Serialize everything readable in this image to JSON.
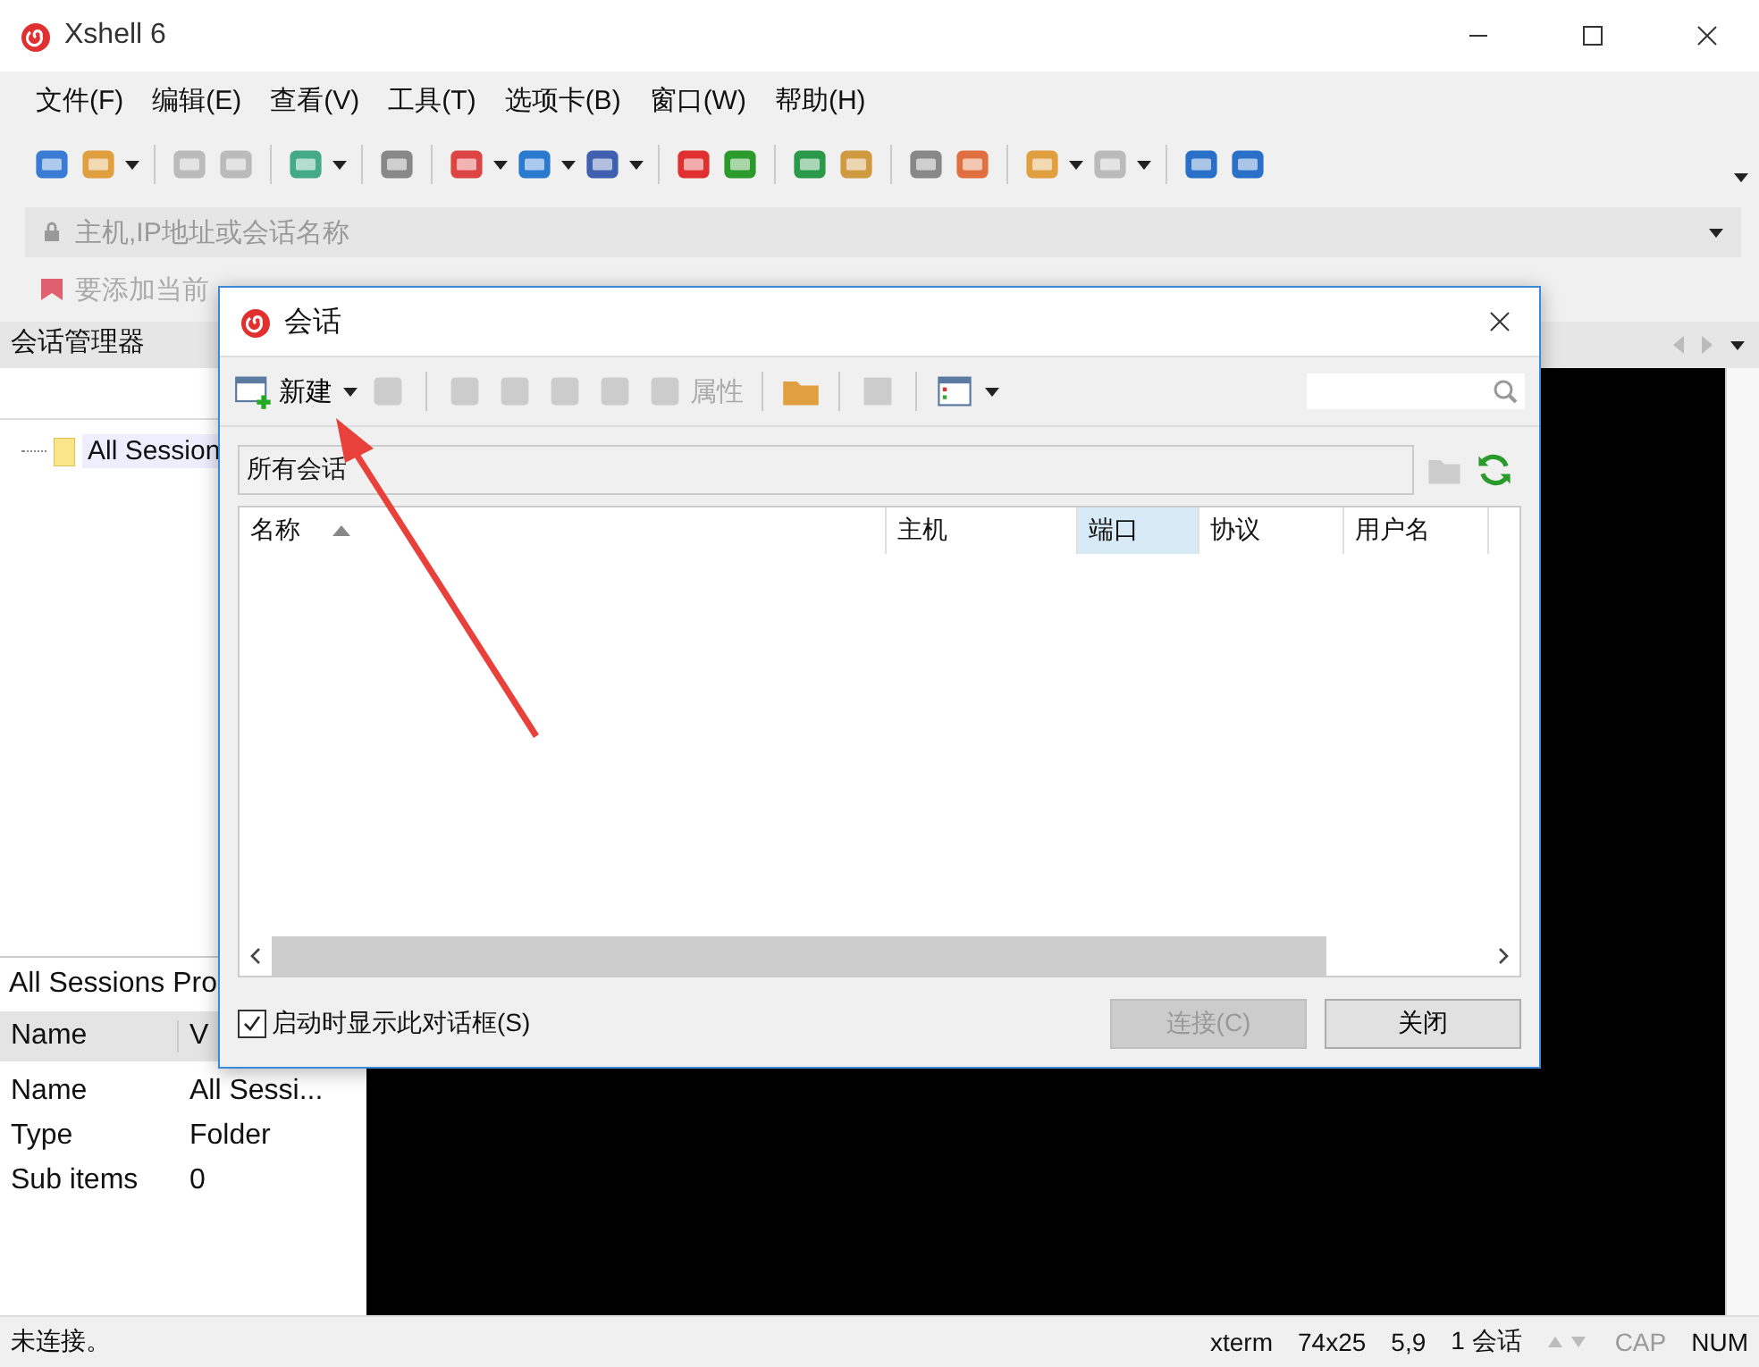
{
  "window": {
    "title": "Xshell 6"
  },
  "menu": [
    "文件(F)",
    "编辑(E)",
    "查看(V)",
    "工具(T)",
    "选项卡(B)",
    "窗口(W)",
    "帮助(H)"
  ],
  "address_bar": {
    "placeholder": "主机,IP地址或会话名称"
  },
  "links_bar": {
    "text": "要添加当前"
  },
  "session_manager": {
    "title": "会话管理器",
    "tree": [
      {
        "label": "All Session",
        "selected": true
      }
    ]
  },
  "properties": {
    "title": "All Sessions Pro",
    "columns": [
      "Name",
      "V"
    ],
    "rows": [
      [
        "Name",
        "All Sessi..."
      ],
      [
        "Type",
        "Folder"
      ],
      [
        "Sub items",
        "0"
      ]
    ]
  },
  "dialog": {
    "title": "会话",
    "new_label": "新建",
    "properties_label": "属性",
    "path": "所有会话",
    "columns": [
      {
        "label": "名称",
        "sorted": true,
        "selected": false
      },
      {
        "label": "主机",
        "sorted": false,
        "selected": false
      },
      {
        "label": "端口",
        "sorted": false,
        "selected": true
      },
      {
        "label": "协议",
        "sorted": false,
        "selected": false
      },
      {
        "label": "用户名",
        "sorted": false,
        "selected": false
      }
    ],
    "startup_checkbox": {
      "label": "启动时显示此对话框(S)",
      "checked": true
    },
    "buttons": [
      {
        "label": "连接(C)",
        "disabled": true
      },
      {
        "label": "关闭",
        "disabled": false
      }
    ]
  },
  "status_bar": {
    "left": "未连接。",
    "terminal": "xterm",
    "size": "74x25",
    "cursor": "5,9",
    "sessions": "1 会话",
    "cap": "CAP",
    "num": "NUM"
  }
}
